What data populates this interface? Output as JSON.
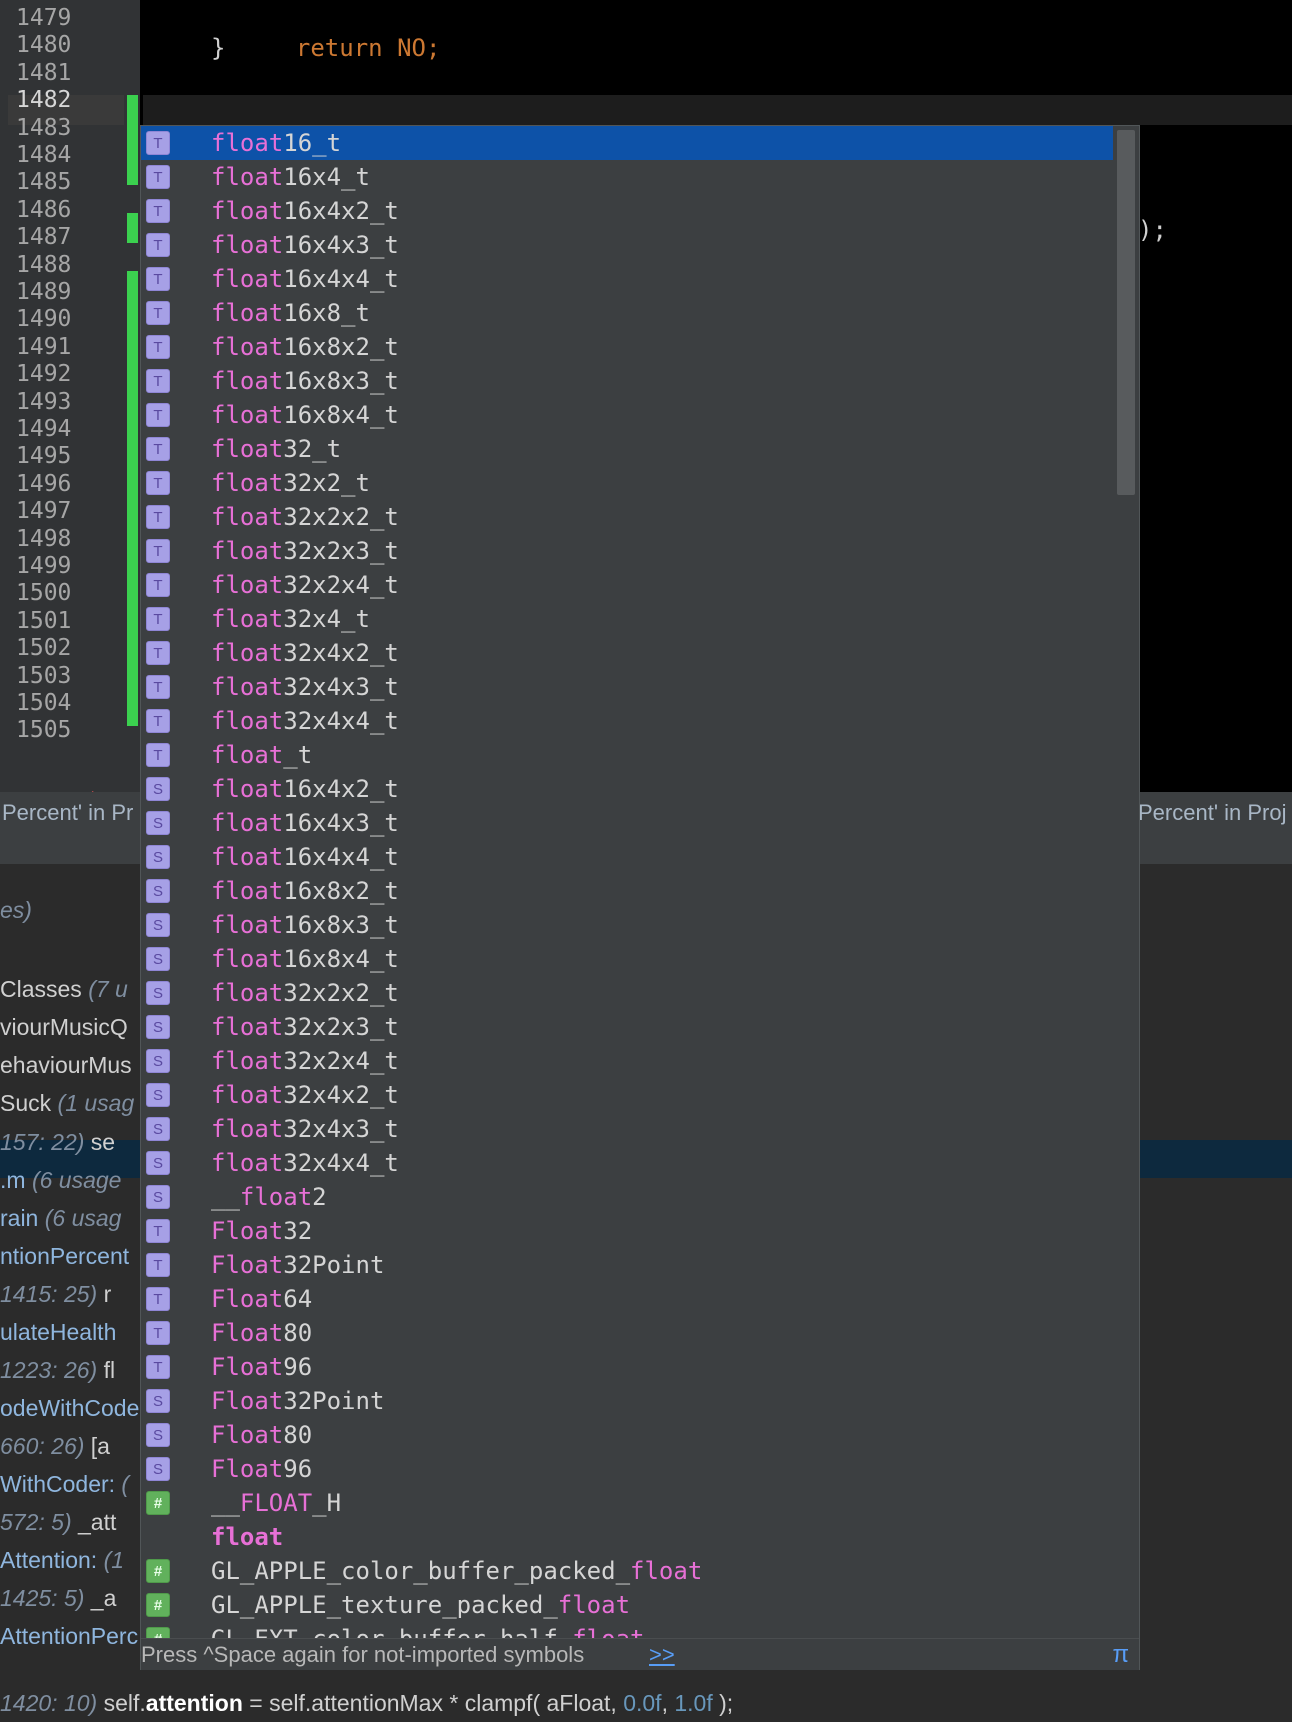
{
  "editor": {
    "line_numbers": [
      "1479",
      "1480",
      "1481",
      "1482",
      "1483",
      "1484",
      "1485",
      "1486",
      "1487",
      "1488",
      "1489",
      "1490",
      "1491",
      "1492",
      "1493",
      "1494",
      "1495",
      "1496",
      "1497",
      "1498",
      "1499",
      "1500",
      "1501",
      "1502",
      "1503",
      "1504",
      "1505"
    ],
    "return_kw": "return",
    "return_val": "NO;",
    "close_brace": "}",
    "typed": "float",
    "right_fragment": ");"
  },
  "find_panel": {
    "tab_left": "Percent' in Pr",
    "tab_right": "Percent' in Proj",
    "rows": [
      {
        "text": "es)",
        "loc": true
      },
      {
        "text": "Classes",
        "extra": "(7 u"
      },
      {
        "text": "viourMusicQ"
      },
      {
        "text": "ehaviourMus"
      },
      {
        "text": "Suck",
        "extra": "(1 usag"
      },
      {
        "text": "157: 22)",
        "extra2": "se",
        "loc_first": true
      },
      {
        "text": ".m",
        "extra": "(6 usage",
        "cls": true
      },
      {
        "text": "rain",
        "extra": "(6 usag",
        "cls": true
      },
      {
        "text": "ntionPercent",
        "cls": true
      },
      {
        "text": "1415: 25)",
        "extra2": "r",
        "loc_first": true
      },
      {
        "text": "ulateHealth",
        "cls": true
      },
      {
        "text": "1223: 26)",
        "extra2": "fl",
        "loc_first": true
      },
      {
        "text": "odeWithCode",
        "cls": true
      },
      {
        "text": "660: 26)",
        "extra2": "[a",
        "loc_first": true
      },
      {
        "text": "WithCoder:",
        "extra": "(",
        "cls": true
      },
      {
        "text": "572: 5)",
        "extra2": "_att",
        "loc_first": true
      },
      {
        "text": "Attention:",
        "extra": "(1",
        "cls": true
      },
      {
        "text": "1425: 5)",
        "extra2": "_a",
        "loc_first": true
      },
      {
        "text": "AttentionPerc",
        "cls": true
      }
    ],
    "bottom_loc": "1420: 10)",
    "bottom_self1": "self.",
    "bottom_attention": "attention",
    "bottom_mid": " = self.attentionMax * clampf( aFloat, ",
    "bottom_n1": "0.0f",
    "bottom_comma": ", ",
    "bottom_n2": "1.0f",
    "bottom_end": " );"
  },
  "completion": {
    "items": [
      {
        "kind": "T",
        "match": "float",
        "rest": "16_t",
        "selected": true
      },
      {
        "kind": "T",
        "match": "float",
        "rest": "16x4_t"
      },
      {
        "kind": "T",
        "match": "float",
        "rest": "16x4x2_t"
      },
      {
        "kind": "T",
        "match": "float",
        "rest": "16x4x3_t"
      },
      {
        "kind": "T",
        "match": "float",
        "rest": "16x4x4_t"
      },
      {
        "kind": "T",
        "match": "float",
        "rest": "16x8_t"
      },
      {
        "kind": "T",
        "match": "float",
        "rest": "16x8x2_t"
      },
      {
        "kind": "T",
        "match": "float",
        "rest": "16x8x3_t"
      },
      {
        "kind": "T",
        "match": "float",
        "rest": "16x8x4_t"
      },
      {
        "kind": "T",
        "match": "float",
        "rest": "32_t"
      },
      {
        "kind": "T",
        "match": "float",
        "rest": "32x2_t"
      },
      {
        "kind": "T",
        "match": "float",
        "rest": "32x2x2_t"
      },
      {
        "kind": "T",
        "match": "float",
        "rest": "32x2x3_t"
      },
      {
        "kind": "T",
        "match": "float",
        "rest": "32x2x4_t"
      },
      {
        "kind": "T",
        "match": "float",
        "rest": "32x4_t"
      },
      {
        "kind": "T",
        "match": "float",
        "rest": "32x4x2_t"
      },
      {
        "kind": "T",
        "match": "float",
        "rest": "32x4x3_t"
      },
      {
        "kind": "T",
        "match": "float",
        "rest": "32x4x4_t"
      },
      {
        "kind": "T",
        "match": "float",
        "rest": "_t"
      },
      {
        "kind": "S",
        "match": "float",
        "rest": "16x4x2_t"
      },
      {
        "kind": "S",
        "match": "float",
        "rest": "16x4x3_t"
      },
      {
        "kind": "S",
        "match": "float",
        "rest": "16x4x4_t"
      },
      {
        "kind": "S",
        "match": "float",
        "rest": "16x8x2_t"
      },
      {
        "kind": "S",
        "match": "float",
        "rest": "16x8x3_t"
      },
      {
        "kind": "S",
        "match": "float",
        "rest": "16x8x4_t"
      },
      {
        "kind": "S",
        "match": "float",
        "rest": "32x2x2_t"
      },
      {
        "kind": "S",
        "match": "float",
        "rest": "32x2x3_t"
      },
      {
        "kind": "S",
        "match": "float",
        "rest": "32x2x4_t"
      },
      {
        "kind": "S",
        "match": "float",
        "rest": "32x4x2_t"
      },
      {
        "kind": "S",
        "match": "float",
        "rest": "32x4x3_t"
      },
      {
        "kind": "S",
        "match": "float",
        "rest": "32x4x4_t"
      },
      {
        "kind": "S",
        "pre": "__",
        "match": "float",
        "rest": "2"
      },
      {
        "kind": "T",
        "match": "Float",
        "rest": "32"
      },
      {
        "kind": "T",
        "match": "Float",
        "rest": "32Point"
      },
      {
        "kind": "T",
        "match": "Float",
        "rest": "64"
      },
      {
        "kind": "T",
        "match": "Float",
        "rest": "80"
      },
      {
        "kind": "T",
        "match": "Float",
        "rest": "96"
      },
      {
        "kind": "S",
        "match": "Float",
        "rest": "32Point"
      },
      {
        "kind": "S",
        "match": "Float",
        "rest": "80"
      },
      {
        "kind": "S",
        "match": "Float",
        "rest": "96"
      },
      {
        "kind": "H",
        "pre": "__",
        "match": "FLOAT",
        "rest": "_H"
      },
      {
        "kind": "",
        "keyword": "float"
      },
      {
        "kind": "H",
        "pre": "GL_APPLE_color_buffer_packed_",
        "match": "float",
        "rest": ""
      },
      {
        "kind": "H",
        "pre": "GL_APPLE_texture_packed_",
        "match": "float",
        "rest": ""
      },
      {
        "kind": "H",
        "pre": "GL_EXT_color_buffer_half_",
        "match": "float",
        "rest": ""
      }
    ],
    "badge_labels": {
      "T": "T",
      "S": "S",
      "H": "#"
    },
    "footer_hint": "Press ^Space again for not-imported symbols",
    "footer_more": ">>",
    "footer_pi": "π"
  }
}
